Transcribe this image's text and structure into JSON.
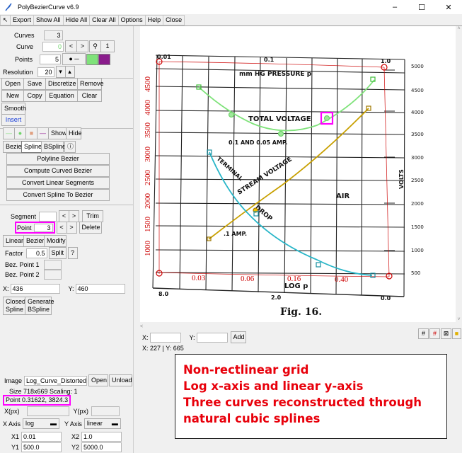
{
  "window": {
    "title": "PolyBezierCurve v6.9"
  },
  "menu": {
    "items": [
      "Export",
      "Show All",
      "Hide All",
      "Clear All",
      "Options",
      "Help",
      "Close"
    ]
  },
  "curves": {
    "label": "Curves",
    "count": "3"
  },
  "curve": {
    "label": "Curve",
    "value": "0",
    "prev": "<",
    "next": ">",
    "target_icon": "target-icon",
    "index": "1"
  },
  "points": {
    "label": "Points",
    "value": "5",
    "color1": "#7fe27a",
    "color2": "#8a1c8c"
  },
  "resolution": {
    "label": "Resolution",
    "value": "20"
  },
  "file_buttons": [
    "Open",
    "Save",
    "Discretize",
    "Remove",
    "New",
    "Copy",
    "Equation",
    "Clear"
  ],
  "smooth": "Smooth",
  "insert": "Insert",
  "style": {
    "show": "Show",
    "hide": "Hide"
  },
  "curve_types": [
    "Bezier",
    "Spline",
    "BSpline"
  ],
  "info_icon": "ⓘ",
  "convert_buttons": [
    "Polyline Bezier",
    "Compute Curved Bezier",
    "Convert Linear Segments",
    "Convert Spline To Bezier"
  ],
  "segment": {
    "label": "Segment",
    "value": "",
    "trim": "Trim"
  },
  "point": {
    "label": "Point",
    "value": "3",
    "delete": "Delete"
  },
  "seg_types": [
    "Linear",
    "Bezier",
    "Modify"
  ],
  "factor": {
    "label": "Factor",
    "value": "0.5",
    "split": "Split",
    "help": "?"
  },
  "bez_point1": {
    "label": "Bez. Point 1",
    "value": ""
  },
  "bez_point2": {
    "label": "Bez. Point 2",
    "value": ""
  },
  "coords": {
    "x_label": "X:",
    "x": "436",
    "y_label": "Y:",
    "y": "460"
  },
  "closed_spline": {
    "line1": "Closed",
    "line2": "Spline"
  },
  "generate_bspline": {
    "line1": "Generate",
    "line2": "BSpline"
  },
  "image_section": {
    "image_label": "Image",
    "image_name": "Log_Curve_Distorted.png",
    "open": "Open",
    "unload": "Unload",
    "size_text": "Size  718x669  Scaling: 1",
    "point_text": "Point  0.31622, 3824.3",
    "x_px_label": "X(px)",
    "y_px_label": "Y(px)",
    "x_axis_label": "X Axis",
    "x_axis_value": "log",
    "y_axis_label": "Y Axis",
    "y_axis_value": "linear",
    "x1_label": "X1",
    "x1": "0.01",
    "x2_label": "X2",
    "x2": "1.0",
    "y1_label": "Y1",
    "y1": "500.0",
    "y2_label": "Y2",
    "y2": "5000.0"
  },
  "canvas_input": {
    "x_label": "X:",
    "x": "",
    "y_label": "Y:",
    "y": "",
    "add": "Add"
  },
  "cursor_readout": "X: 227 | Y: 665",
  "bottom_icons": [
    "#",
    "#",
    "⊠",
    "■"
  ],
  "figure": {
    "top_ticks": [
      "0.01",
      "0.1",
      "1.0"
    ],
    "top_title": "mm HG PRESSURE  p",
    "left_red_ticks": [
      "1000",
      "1500",
      "2000",
      "2500",
      "3000",
      "3500",
      "4000",
      "4500"
    ],
    "right_ticks": [
      "5000",
      "4500",
      "4000",
      "3500",
      "3000",
      "2500",
      "2000",
      "1500",
      "1000",
      "500"
    ],
    "volts": "VOLTS",
    "bottom_red_ticks": [
      "0.03",
      "0.06",
      "0.16",
      "0.40"
    ],
    "bottom_black_ticks": [
      "8.0",
      "2.0",
      "0.0"
    ],
    "log_label": "LOG  p",
    "fig_label": "Fig. 16.",
    "labels": {
      "total_voltage": "TOTAL VOLTAGE",
      "amp1": "0.1 AND 0.05 AMP.",
      "terminal": "TERMINAL",
      "stream": "STREAM VOLTAGE",
      "drop": "DROP",
      "amp2": ".1 AMP.",
      "air": "AIR"
    }
  },
  "annotation": {
    "lines": [
      "Non-rectlinear grid",
      "Log x-axis and linear y-axis",
      "Three curves reconstructed through",
      "natural cubic splines"
    ],
    "color": "#e8000b"
  },
  "colors": {
    "highlight": "#ff00ff",
    "green_curve": "#7fe27a",
    "gold_curve": "#c8a000",
    "cyan_curve": "#29b6c8",
    "red_axis": "#cc0000"
  }
}
